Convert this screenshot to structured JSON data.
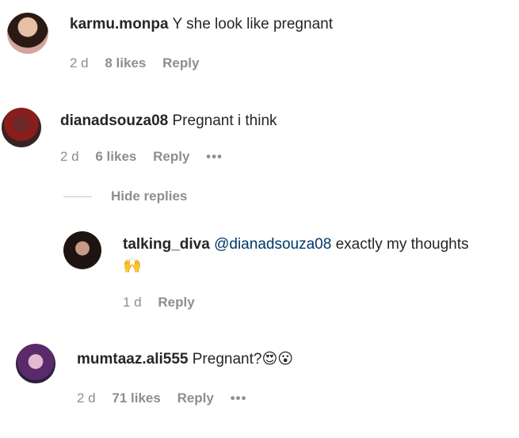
{
  "comments": [
    {
      "username": "karmu.monpa",
      "text": "Y she look like pregnant",
      "time": "2 d",
      "likes": "8 likes",
      "reply": "Reply"
    },
    {
      "username": "dianadsouza08",
      "text": "Pregnant i think",
      "time": "2 d",
      "likes": "6 likes",
      "reply": "Reply",
      "more": "•••"
    },
    {
      "username": "mumtaaz.ali555",
      "text": "Pregnant?",
      "emojis": "😍😮",
      "time": "2 d",
      "likes": "71 likes",
      "reply": "Reply",
      "more": "•••"
    }
  ],
  "hide_replies_label": "Hide replies",
  "reply": {
    "username": "talking_diva",
    "mention": "@dianadsouza08",
    "text": "exactly my thoughts",
    "emoji": "🙌",
    "time": "1 d",
    "reply": "Reply"
  }
}
